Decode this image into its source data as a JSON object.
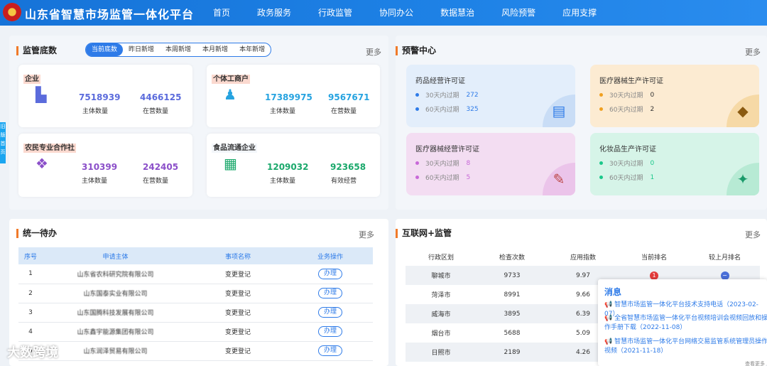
{
  "header": {
    "title": "山东省智慧市场监管一体化平台",
    "nav": [
      "首页",
      "政务服务",
      "行政监管",
      "协同办公",
      "数据慧治",
      "风险预警",
      "应用支撑"
    ]
  },
  "supervision": {
    "title": "监管底数",
    "more": "更多",
    "tabs": [
      "当前底数",
      "昨日新增",
      "本周新增",
      "本月新增",
      "本年新增"
    ],
    "cards": [
      {
        "label": "企业",
        "v1": "7518939",
        "l1": "主体数量",
        "v2": "4466125",
        "l2": "在营数量",
        "color": "#5b6bdc",
        "icon": "building-icon"
      },
      {
        "label": "个体工商户",
        "v1": "17389975",
        "l1": "主体数量",
        "v2": "9567671",
        "l2": "在营数量",
        "color": "#26a3e0",
        "icon": "person-icon"
      },
      {
        "label": "农民专业合作社",
        "v1": "310399",
        "l1": "主体数量",
        "v2": "242405",
        "l2": "在营数量",
        "color": "#8b4fc9",
        "icon": "cooperative-icon"
      },
      {
        "label": "食品流通企业",
        "v1": "1209032",
        "l1": "主体数量",
        "v2": "923658",
        "l2": "有效经营",
        "color": "#1aa86b",
        "icon": "store-icon"
      }
    ]
  },
  "warning": {
    "title": "预警中心",
    "more": "更多",
    "items": [
      {
        "title": "药品经营许可证",
        "r1": "30天内过期",
        "n1": "272",
        "r2": "60天内过期",
        "n2": "325",
        "dot": "#2e7be8",
        "numColor": "#2e7be8"
      },
      {
        "title": "医疗器械生产许可证",
        "r1": "30天内过期",
        "n1": "0",
        "r2": "60天内过期",
        "n2": "2",
        "dot": "#f0a020",
        "numColor": "#333"
      },
      {
        "title": "医疗器械经营许可证",
        "r1": "30天内过期",
        "n1": "8",
        "r2": "60天内过期",
        "n2": "5",
        "dot": "#c868d8",
        "numColor": "#c868d8"
      },
      {
        "title": "化妆品生产许可证",
        "r1": "30天内过期",
        "n1": "0",
        "r2": "60天内过期",
        "n2": "1",
        "dot": "#1ac88a",
        "numColor": "#1ac88a"
      }
    ]
  },
  "todo": {
    "title": "统一待办",
    "more": "更多",
    "headers": [
      "序号",
      "申请主体",
      "事项名称",
      "业务操作"
    ],
    "rows": [
      {
        "no": "1",
        "subject": "山东省农科研究院有限公司",
        "item": "变更登记",
        "op": "办理"
      },
      {
        "no": "2",
        "subject": "山东国泰实业有限公司",
        "item": "变更登记",
        "op": "办理"
      },
      {
        "no": "3",
        "subject": "山东国腾科技发展有限公司",
        "item": "变更登记",
        "op": "办理"
      },
      {
        "no": "4",
        "subject": "山东鑫宇能源集团有限公司",
        "item": "变更登记",
        "op": "办理"
      },
      {
        "no": "5",
        "subject": "山东润泽贸易有限公司",
        "item": "变更登记",
        "op": "办理"
      }
    ]
  },
  "internet": {
    "title": "互联网+监管",
    "more": "更多",
    "headers": [
      "行政区划",
      "检查次数",
      "应用指数",
      "当前排名",
      "较上月排名"
    ],
    "rows": [
      {
        "region": "聊城市",
        "checks": "9733",
        "index": "9.97",
        "rank": "1"
      },
      {
        "region": "菏泽市",
        "checks": "8991",
        "index": "9.66"
      },
      {
        "region": "威海市",
        "checks": "3895",
        "index": "6.39"
      },
      {
        "region": "烟台市",
        "checks": "5688",
        "index": "5.09"
      },
      {
        "region": "日照市",
        "checks": "2189",
        "index": "4.26"
      }
    ]
  },
  "messages": {
    "title": "消息",
    "items": [
      "智慧市场监管一体化平台技术支持电话（2023-02-07）",
      "全省智慧市场监管一体化平台视频培训会视频回放和操作手册下载（2022-11-08）",
      "智慧市场监管一体化平台网络交易监管系统管理员操作视频（2021-11-18）"
    ],
    "footer": "查看更多"
  },
  "sidetab": "旧版首页",
  "watermark": "大数跨境"
}
